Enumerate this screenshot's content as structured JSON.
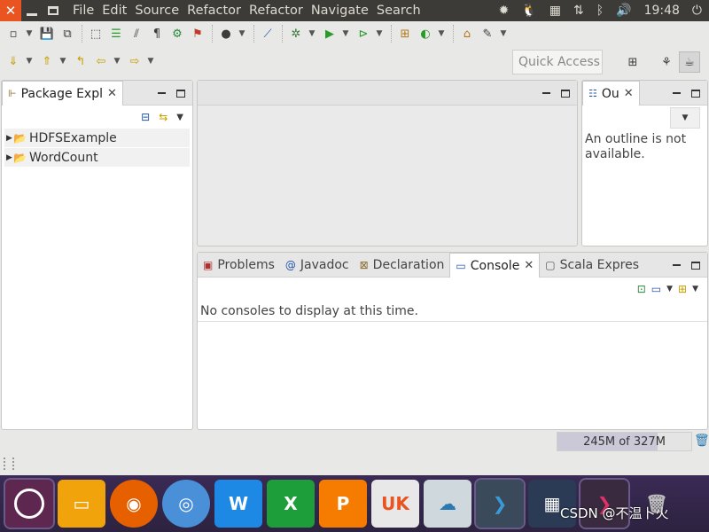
{
  "topbar": {
    "menu": [
      "File",
      "Edit",
      "Source",
      "Refactor",
      "Refactor",
      "Navigate",
      "Search"
    ],
    "time": "19:48"
  },
  "toolbar": {
    "quick_access_placeholder": "Quick Access"
  },
  "package_explorer": {
    "tab_label": "Package Expl",
    "items": [
      {
        "label": "HDFSExample"
      },
      {
        "label": "WordCount"
      }
    ]
  },
  "outline": {
    "tab_label": "Ou",
    "message": "An outline is not available."
  },
  "bottom_panel": {
    "tabs": [
      {
        "label": "Problems",
        "icon": "problems-icon"
      },
      {
        "label": "Javadoc",
        "icon": "at-icon"
      },
      {
        "label": "Declaration",
        "icon": "declaration-icon"
      },
      {
        "label": "Console",
        "icon": "console-icon",
        "active": true
      },
      {
        "label": "Scala Expres",
        "icon": "scala-icon"
      }
    ],
    "console_message": "No consoles to display at this time."
  },
  "status": {
    "heap": "245M of 327M",
    "heap_used_fraction": 0.75
  },
  "dock": {
    "apps": [
      {
        "name": "ubuntu-logo",
        "color": "#5e2750"
      },
      {
        "name": "files",
        "color": "#f0a30a"
      },
      {
        "name": "firefox",
        "color": "#e66000"
      },
      {
        "name": "chromium",
        "color": "#4a90d9"
      },
      {
        "name": "writer",
        "color": "#1e88e5"
      },
      {
        "name": "calc",
        "color": "#1e9e3a"
      },
      {
        "name": "impress",
        "color": "#f57c00"
      },
      {
        "name": "software-center",
        "color": "#e8e8e8"
      },
      {
        "name": "remmina",
        "color": "#cfd8dc"
      },
      {
        "name": "vscode",
        "color": "#3b4a5a"
      },
      {
        "name": "launcher",
        "color": "#2b3a55"
      },
      {
        "name": "terminal",
        "color": "#3a2a40"
      },
      {
        "name": "trash",
        "color": "#4a4a4a"
      }
    ],
    "watermark": "CSDN @不温卜火"
  }
}
